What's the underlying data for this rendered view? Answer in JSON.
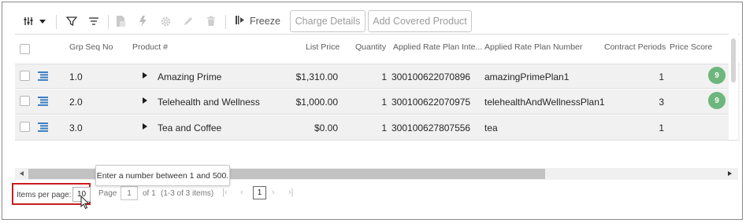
{
  "toolbar": {
    "icons": [
      "columns-menu-icon",
      "filter-icon",
      "clear-filter-icon",
      "copy-icon",
      "recalculate-icon",
      "settings-icon",
      "edit-icon",
      "delete-icon",
      "freeze-icon"
    ],
    "freeze_label": "Freeze",
    "charge_details_label": "Charge Details",
    "add_covered_product_label": "Add Covered Product"
  },
  "grid": {
    "columns": [
      "Grp Seq No",
      "Product #",
      "List Price",
      "Quantity",
      "Applied Rate Plan Inte...",
      "Applied Rate Plan Number",
      "Contract Periods",
      "Price Score"
    ],
    "rows": [
      {
        "seq": "1.0",
        "product": "Amazing Prime",
        "list_price": "$1,310.00",
        "quantity": "1",
        "rate_plan_int": "300100622070896",
        "rate_plan_number": "amazingPrimePlan1",
        "contract_periods": "1",
        "price_score": "9"
      },
      {
        "seq": "2.0",
        "product": "Telehealth and Wellness",
        "list_price": "$1,000.00",
        "quantity": "1",
        "rate_plan_int": "300100622070975",
        "rate_plan_number": "telehealthAndWellnessPlan1",
        "contract_periods": "3",
        "price_score": "9"
      },
      {
        "seq": "3.0",
        "product": "Tea and Coffee",
        "list_price": "$0.00",
        "quantity": "1",
        "rate_plan_int": "300100627807556",
        "rate_plan_number": "tea",
        "contract_periods": "1",
        "price_score": ""
      }
    ]
  },
  "tooltip": "Enter a number between 1 and 500.",
  "pager": {
    "items_per_page_label": "Items per page:",
    "items_per_page_value": "10",
    "page_label": "Page",
    "page_input": "1",
    "of_label": "of 1",
    "range_label": "(1-3 of 3 items)",
    "current_page": "1"
  },
  "colors": {
    "highlight_border": "#c81e1e",
    "score_badge": "#6db67d"
  }
}
